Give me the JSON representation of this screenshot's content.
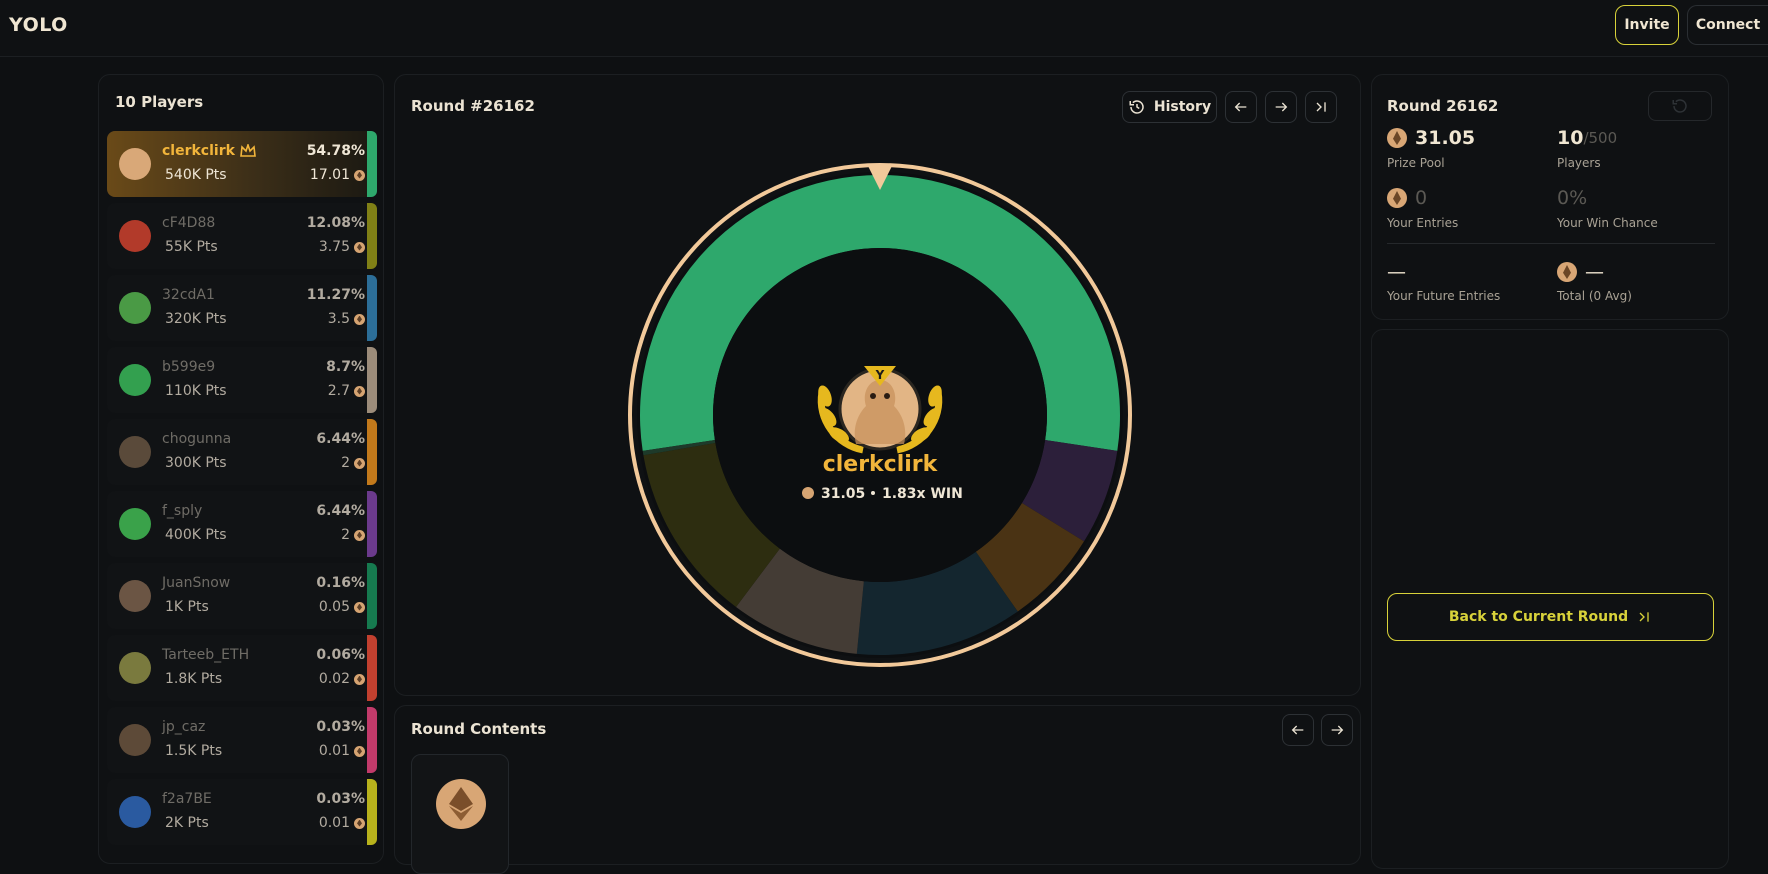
{
  "app": {
    "logo": "YOLO"
  },
  "header": {
    "invite_label": "Invite",
    "connect_label": "Connect"
  },
  "players": {
    "title": "10 Players",
    "items": [
      {
        "name": "clerkclirk",
        "pts": "540K Pts",
        "pct": "54.78%",
        "value": "17.01",
        "color": "#2ea86c",
        "avatar": "#d9a878",
        "top": true
      },
      {
        "name": "cF4D88",
        "pts": "55K Pts",
        "pct": "12.08%",
        "value": "3.75",
        "color": "#808016",
        "avatar": "#b23a2a"
      },
      {
        "name": "32cdA1",
        "pts": "320K Pts",
        "pct": "11.27%",
        "value": "3.5",
        "color": "#2c6e98",
        "avatar": "#4a9a45"
      },
      {
        "name": "b599e9",
        "pts": "110K Pts",
        "pct": "8.7%",
        "value": "2.7",
        "color": "#9c8c7a",
        "avatar": "#33a04f"
      },
      {
        "name": "chogunna",
        "pts": "300K Pts",
        "pct": "6.44%",
        "value": "2",
        "color": "#c2791b",
        "avatar": "#5a4a3a"
      },
      {
        "name": "f_sply",
        "pts": "400K Pts",
        "pct": "6.44%",
        "value": "2",
        "color": "#6b3a8c",
        "avatar": "#3aa24a"
      },
      {
        "name": "JuanSnow",
        "pts": "1K Pts",
        "pct": "0.16%",
        "value": "0.05",
        "color": "#167a4f",
        "avatar": "#6b5544"
      },
      {
        "name": "Tarteeb_ETH",
        "pts": "1.8K Pts",
        "pct": "0.06%",
        "value": "0.02",
        "color": "#c2402f",
        "avatar": "#7a7a3e"
      },
      {
        "name": "jp_caz",
        "pts": "1.5K Pts",
        "pct": "0.03%",
        "value": "0.01",
        "color": "#c23a6a",
        "avatar": "#5d4a38"
      },
      {
        "name": "f2a7BE",
        "pts": "2K Pts",
        "pct": "0.03%",
        "value": "0.01",
        "color": "#b8b21c",
        "avatar": "#2a5aa0"
      }
    ]
  },
  "round": {
    "title": "Round #26162",
    "history_label": "History",
    "winner_name": "clerkclirk",
    "winner_value": "31.05",
    "winner_multiplier": "1.83x WIN",
    "winner_badge": "Y",
    "wheel_segments": [
      {
        "pct": 54.78,
        "color": "#2ea86c"
      },
      {
        "pct": 6.44,
        "color": "#2c1f3a"
      },
      {
        "pct": 6.44,
        "color": "#4a3314"
      },
      {
        "pct": 11.27,
        "color": "#14262f"
      },
      {
        "pct": 8.7,
        "color": "#443c35"
      },
      {
        "pct": 12.08,
        "color": "#2d2d10"
      },
      {
        "pct": 0.29,
        "color": "#1e3a2a"
      }
    ]
  },
  "contents": {
    "title": "Round Contents"
  },
  "info": {
    "title": "Round 26162",
    "prize_pool_value": "31.05",
    "prize_pool_label": "Prize Pool",
    "players_value": "10",
    "players_max": "/500",
    "players_label": "Players",
    "entries_value": "0",
    "entries_label": "Your Entries",
    "win_chance_value": "0%",
    "win_chance_label": "Your Win Chance",
    "future_entries_value": "—",
    "future_entries_label": "Your Future Entries",
    "total_value": "—",
    "total_label": "Total (0 Avg)"
  },
  "side": {
    "back_label": "Back to Current Round"
  }
}
